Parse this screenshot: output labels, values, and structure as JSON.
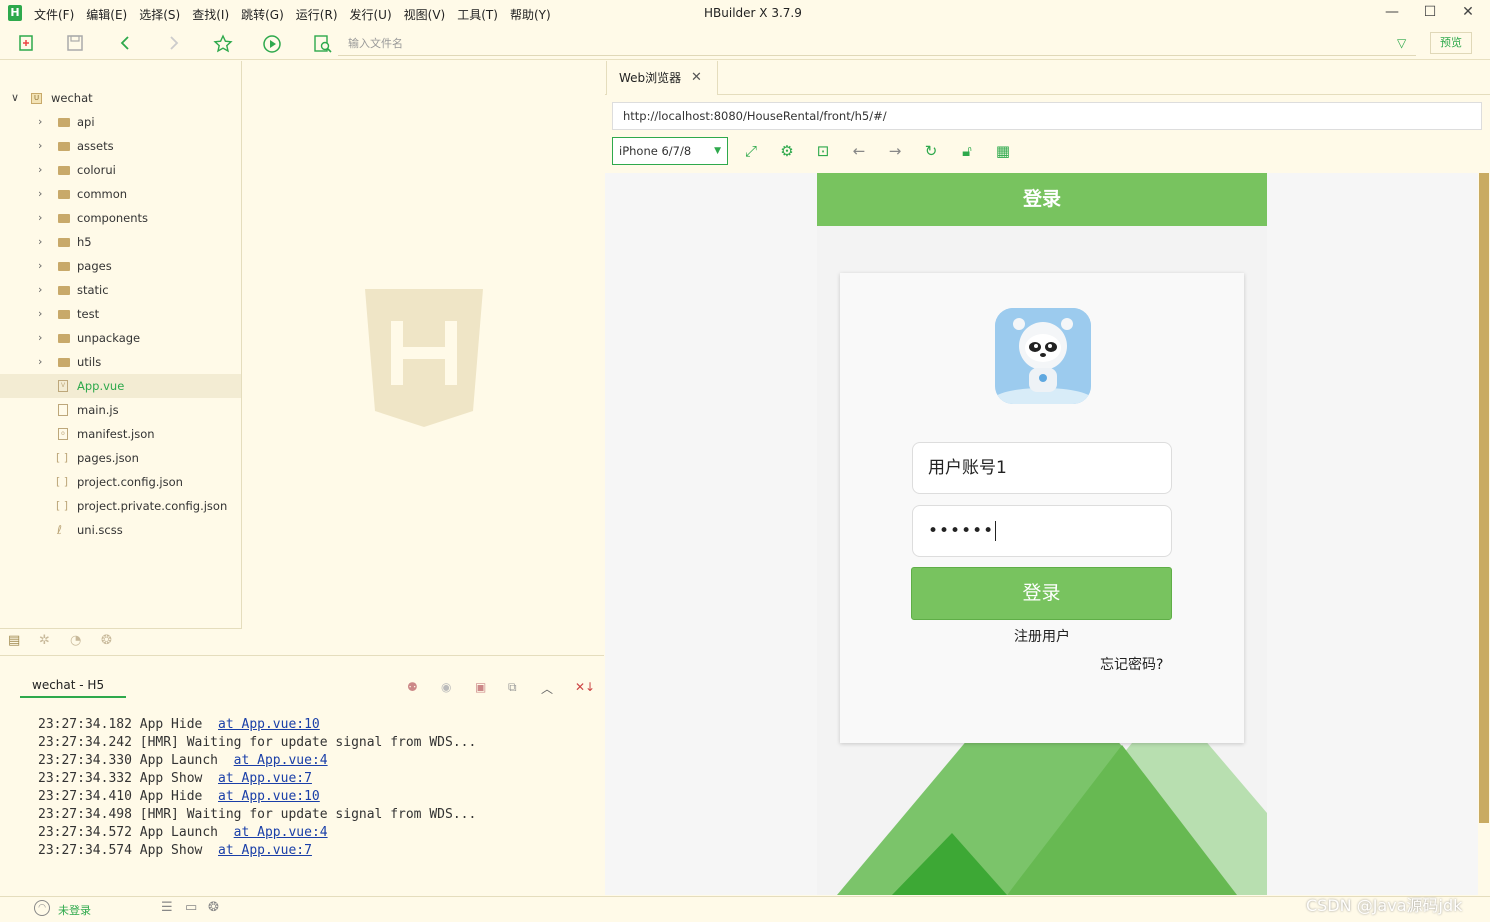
{
  "app": {
    "title": "HBuilder X 3.7.9",
    "logo_letter": "H",
    "menus": [
      "文件(F)",
      "编辑(E)",
      "选择(S)",
      "查找(I)",
      "跳转(G)",
      "运行(R)",
      "发行(U)",
      "视图(V)",
      "工具(T)",
      "帮助(Y)"
    ],
    "window_controls": {
      "minimize": "—",
      "maximize": "☐",
      "close": "✕"
    }
  },
  "toolbar": {
    "file_search_placeholder": "输入文件名",
    "preview_label": "预览"
  },
  "project_tree": {
    "root": "wechat",
    "folders": [
      "api",
      "assets",
      "colorui",
      "common",
      "components",
      "h5",
      "pages",
      "static",
      "test",
      "unpackage",
      "utils"
    ],
    "files": [
      {
        "name": "App.vue",
        "selected": true,
        "icon": "vue-file-icon"
      },
      {
        "name": "main.js",
        "selected": false,
        "icon": "js-file-icon"
      },
      {
        "name": "manifest.json",
        "selected": false,
        "icon": "manifest-icon"
      },
      {
        "name": "pages.json",
        "selected": false,
        "icon": "json-file-icon"
      },
      {
        "name": "project.config.json",
        "selected": false,
        "icon": "json-file-icon"
      },
      {
        "name": "project.private.config.json",
        "selected": false,
        "icon": "json-file-icon"
      },
      {
        "name": "uni.scss",
        "selected": false,
        "icon": "scss-file-icon"
      }
    ]
  },
  "console": {
    "tab_label": "wechat - H5",
    "lines": [
      {
        "text": "23:27:34.182 App Hide  ",
        "link": "at App.vue:10"
      },
      {
        "text": "23:27:34.242 [HMR] Waiting for update signal from WDS...",
        "link": ""
      },
      {
        "text": "23:27:34.330 App Launch  ",
        "link": "at App.vue:4"
      },
      {
        "text": "23:27:34.332 App Show  ",
        "link": "at App.vue:7"
      },
      {
        "text": "23:27:34.410 App Hide  ",
        "link": "at App.vue:10"
      },
      {
        "text": "23:27:34.498 [HMR] Waiting for update signal from WDS...",
        "link": ""
      },
      {
        "text": "23:27:34.572 App Launch  ",
        "link": "at App.vue:4"
      },
      {
        "text": "23:27:34.574 App Show  ",
        "link": "at App.vue:7"
      }
    ]
  },
  "status": {
    "login_state": "未登录"
  },
  "browser": {
    "tab_label": "Web浏览器",
    "url": "http://localhost:8080/HouseRental/front/h5/#/",
    "device": "iPhone 6/7/8"
  },
  "phone": {
    "header_title": "登录",
    "account_value": "用户账号1",
    "password_mask": "••••••",
    "login_button": "登录",
    "register_link": "注册用户",
    "forgot_link": "忘记密码?"
  },
  "watermark": "CSDN @Java源码jdk",
  "colors": {
    "accent": "#2ea94c",
    "phone_green": "#78c35f",
    "ide_bg": "#fffae8"
  }
}
